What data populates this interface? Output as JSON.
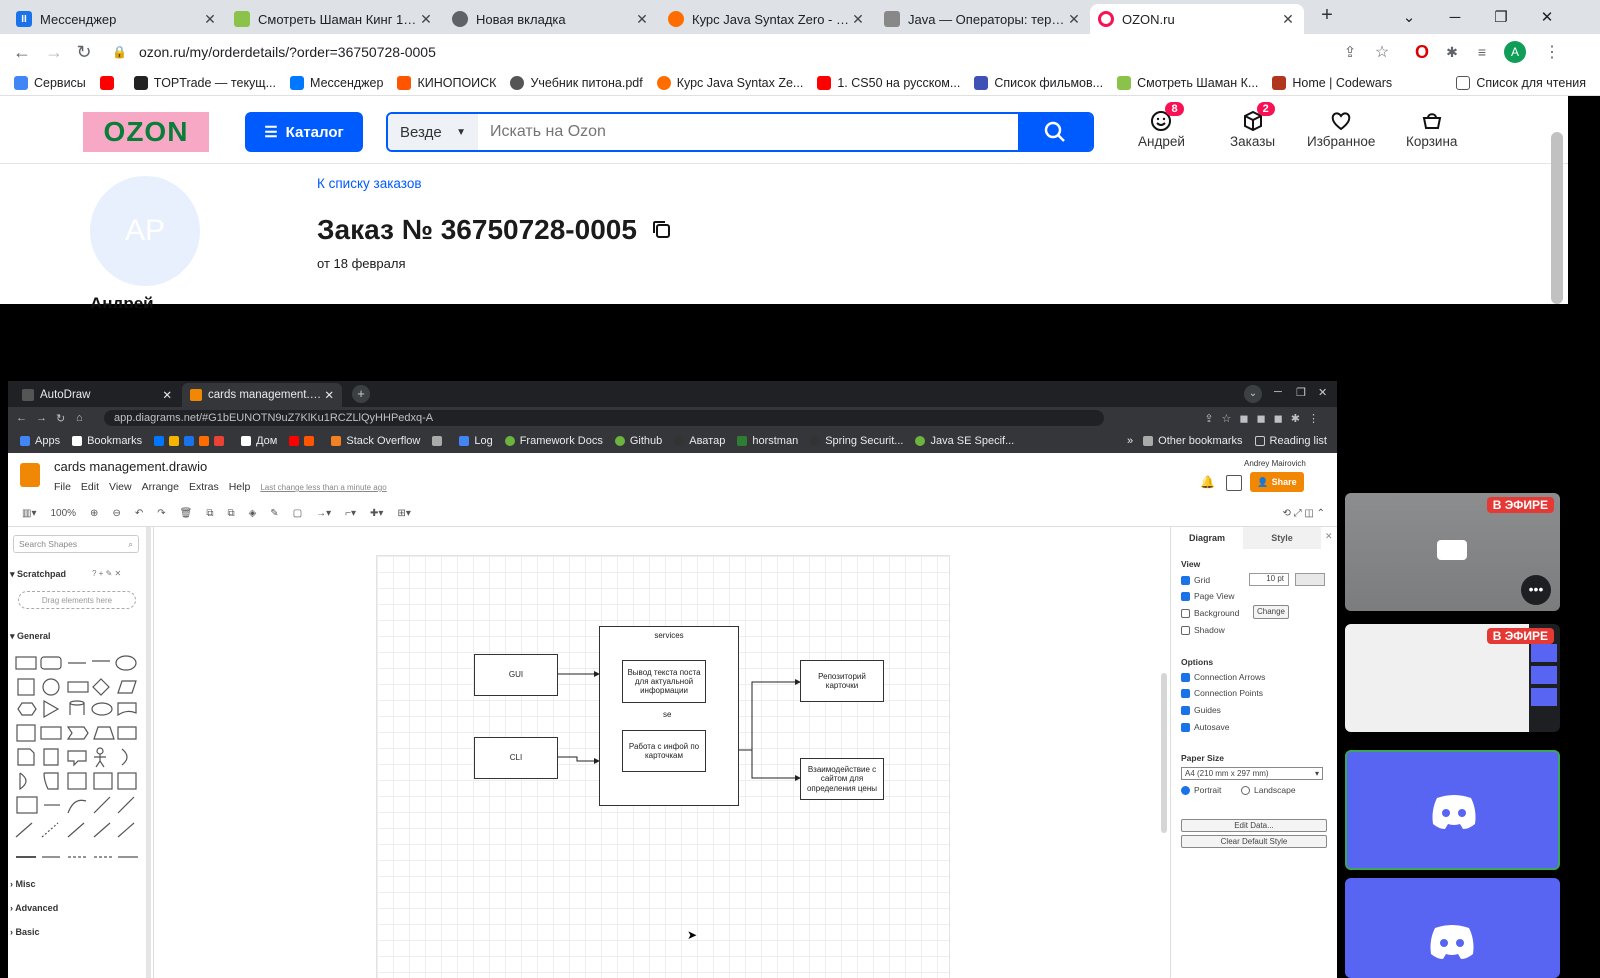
{
  "outer_browser": {
    "tabs": [
      {
        "title": "Мессенджер",
        "icon": "vk-messenger-icon",
        "color": "#1a73e8"
      },
      {
        "title": "Смотреть Шаман Кинг 1 сезон",
        "icon": "shaman-king-icon",
        "color": "#8bc34a"
      },
      {
        "title": "Новая вкладка",
        "icon": "chrome-icon",
        "color": "#5f6368"
      },
      {
        "title": "Курс Java Syntax Zero - Лекция",
        "icon": "javarush-icon",
        "color": "#ff6d00"
      },
      {
        "title": "Java — Операторы: тернарный",
        "icon": "proglib-icon",
        "color": "#555"
      },
      {
        "title": "OZON.ru",
        "icon": "ozon-icon",
        "color": "#005bff"
      }
    ],
    "url": "ozon.ru/my/orderdetails/?order=36750728-0005",
    "profile_initial": "A",
    "bookmarks": [
      {
        "label": "Сервисы",
        "color": "#4285f4"
      },
      {
        "label": "",
        "color": "#ff0000"
      },
      {
        "label": "TOPTrade — текущ...",
        "color": "#222"
      },
      {
        "label": "Мессенджер",
        "color": "#0077ff"
      },
      {
        "label": "КИНОПОИСК",
        "color": "#ff5500"
      },
      {
        "label": "Учебник питона.pdf",
        "color": "#555"
      },
      {
        "label": "Курс Java Syntax Ze...",
        "color": "#ff6d00"
      },
      {
        "label": "1. CS50 на русском...",
        "color": "#ff0000"
      },
      {
        "label": "Список фильмов...",
        "color": "#3f51b5"
      },
      {
        "label": "Смотреть Шаман К...",
        "color": "#8bc34a"
      },
      {
        "label": "Home | Codewars",
        "color": "#b1361e"
      }
    ],
    "reading_list": "Список для чтения"
  },
  "ozon": {
    "logo": "OZON",
    "catalog_label": "Каталог",
    "search_scope": "Везде",
    "search_placeholder": "Искать на Ozon",
    "header_items": [
      {
        "label": "Андрей",
        "icon": "profile-smile-icon",
        "badge": "8"
      },
      {
        "label": "Заказы",
        "icon": "box-icon",
        "badge": "2"
      },
      {
        "label": "Избранное",
        "icon": "heart-icon",
        "badge": ""
      },
      {
        "label": "Корзина",
        "icon": "cart-icon",
        "badge": ""
      }
    ],
    "avatar_initials": "AP",
    "user_name": "Андрей",
    "back_link": "К списку заказов",
    "order_title": "Заказ № 36750728-0005",
    "order_date": "от 18 февраля",
    "accent": "#005bff",
    "badge_color": "#f91155"
  },
  "shared_screen": {
    "tabs": [
      {
        "title": "AutoDraw"
      },
      {
        "title": "cards management.draw..."
      }
    ],
    "url": "app.diagrams.net/#G1bEUNOTN9uZ7KlKu1RCZLlQyHHPedxq-A",
    "bookmarks": [
      "Apps",
      "Bookmarks",
      "Дом",
      "Stack Overflow",
      "Log",
      "Framework Docs",
      "Github",
      "Аватар",
      "horstman",
      "Spring Securit...",
      "Java SE Specif..."
    ],
    "other_bookmarks": "Other bookmarks",
    "reading_list": "Reading list",
    "drawio": {
      "file_title": "cards management.drawio",
      "user": "Andrey Mairovich",
      "share": "Share",
      "menu": [
        "File",
        "Edit",
        "View",
        "Arrange",
        "Extras",
        "Help"
      ],
      "last_change": "Last change less than a minute ago",
      "zoom": "100%",
      "search_shapes": "Search Shapes",
      "scratchpad": "Scratchpad",
      "drag_here": "Drag elements here",
      "general": "General",
      "sections": [
        "Misc",
        "Advanced",
        "Basic"
      ],
      "diagram": {
        "gui": "GUI",
        "cli": "CLI",
        "services": "services",
        "output": "Вывод текста поста для актуальной информации",
        "work": "Работа с инфой по карточкам",
        "edge_label": "se",
        "repo": "Репозиторий карточки",
        "site": "Взаимодействие с сайтом для определения цены"
      },
      "panel": {
        "tab_diagram": "Diagram",
        "tab_style": "Style",
        "view": "View",
        "grid": "Grid",
        "grid_size": "10 pt",
        "page_view": "Page View",
        "background": "Background",
        "change": "Change",
        "shadow": "Shadow",
        "options": "Options",
        "conn_arrows": "Connection Arrows",
        "conn_points": "Connection Points",
        "guides": "Guides",
        "autosave": "Autosave",
        "paper_size": "Paper Size",
        "paper_value": "A4 (210 mm x 297 mm)",
        "portrait": "Portrait",
        "landscape": "Landscape",
        "edit_data": "Edit Data...",
        "clear_style": "Clear Default Style"
      }
    }
  },
  "participants": {
    "live_label": "В ЭФИРЕ",
    "discord_color": "#5865f2"
  }
}
